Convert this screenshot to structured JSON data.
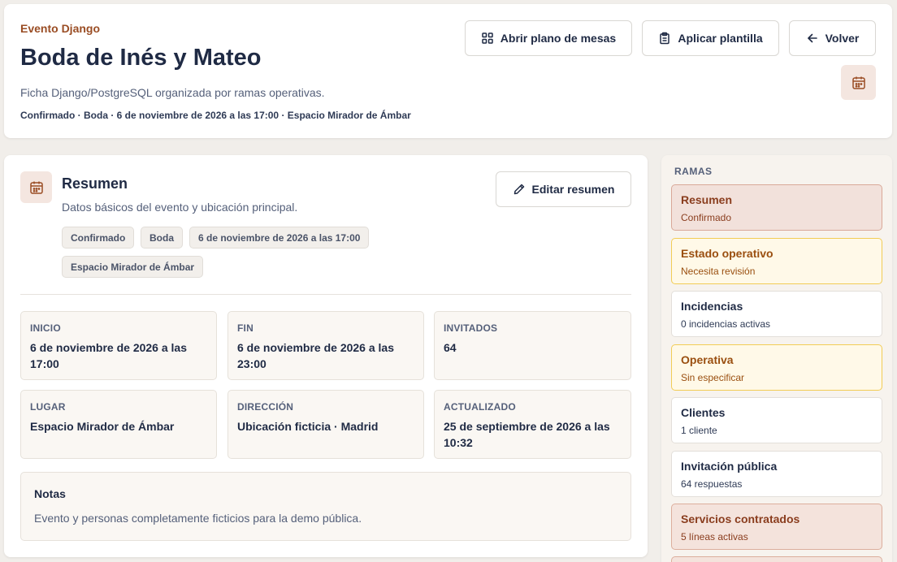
{
  "header": {
    "eyebrow": "Evento Django",
    "title": "Boda de Inés y Mateo",
    "subtitle": "Ficha Django/PostgreSQL organizada por ramas operativas.",
    "meta": "Confirmado · Boda · 6 de noviembre de 2026 a las 17:00 · Espacio Mirador de Ámbar",
    "buttons": {
      "seating": "Abrir plano de mesas",
      "template": "Aplicar plantilla",
      "back": "Volver"
    }
  },
  "summary": {
    "title": "Resumen",
    "description": "Datos básicos del evento y ubicación principal.",
    "edit_button": "Editar resumen",
    "tags": [
      "Confirmado",
      "Boda",
      "6 de noviembre de 2026 a las 17:00",
      "Espacio Mirador de Ámbar"
    ],
    "stats": [
      {
        "label": "INICIO",
        "value": "6 de noviembre de 2026 a las 17:00"
      },
      {
        "label": "FIN",
        "value": "6 de noviembre de 2026 a las 23:00"
      },
      {
        "label": "INVITADOS",
        "value": "64"
      },
      {
        "label": "LUGAR",
        "value": "Espacio Mirador de Ámbar"
      },
      {
        "label": "DIRECCIÓN",
        "value": "Ubicación ficticia · Madrid"
      },
      {
        "label": "ACTUALIZADO",
        "value": "25 de septiembre de 2026 a las 10:32"
      }
    ],
    "notes": {
      "title": "Notas",
      "text": "Evento y personas completamente ficticios para la demo pública."
    }
  },
  "sidebar": {
    "heading": "RAMAS",
    "items": [
      {
        "title": "Resumen",
        "sub": "Confirmado",
        "state": "active"
      },
      {
        "title": "Estado operativo",
        "sub": "Necesita revisión",
        "state": "warn"
      },
      {
        "title": "Incidencias",
        "sub": "0 incidencias activas",
        "state": "normal"
      },
      {
        "title": "Operativa",
        "sub": "Sin especificar",
        "state": "warn"
      },
      {
        "title": "Clientes",
        "sub": "1 cliente",
        "state": "normal"
      },
      {
        "title": "Invitación pública",
        "sub": "64 respuestas",
        "state": "normal"
      },
      {
        "title": "Servicios contratados",
        "sub": "5 líneas activas",
        "state": "danger"
      }
    ]
  },
  "colors": {
    "accent": "#9a4d24",
    "background": "#f1eeea",
    "warn_border": "#f2cc55",
    "active_bg": "#f2e1db"
  },
  "icons": {
    "seating": "grid-icon",
    "template": "clipboard-icon",
    "back": "arrow-left-icon",
    "calendar": "calendar-icon",
    "edit": "pencil-icon"
  }
}
